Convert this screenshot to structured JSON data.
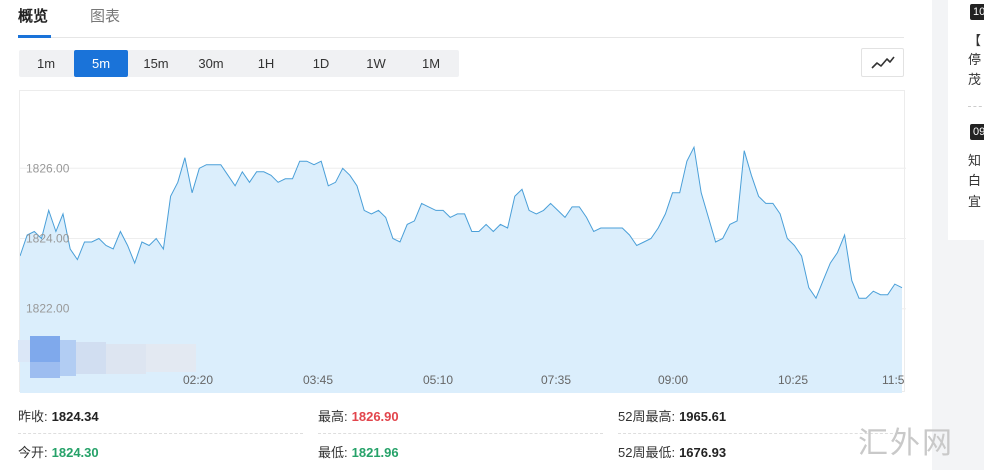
{
  "tabs": [
    {
      "label": "概览",
      "active": true
    },
    {
      "label": "图表",
      "active": false
    }
  ],
  "ranges": [
    {
      "label": "1m",
      "active": false
    },
    {
      "label": "5m",
      "active": true
    },
    {
      "label": "15m",
      "active": false
    },
    {
      "label": "30m",
      "active": false
    },
    {
      "label": "1H",
      "active": false
    },
    {
      "label": "1D",
      "active": false
    },
    {
      "label": "1W",
      "active": false
    },
    {
      "label": "1M",
      "active": false
    }
  ],
  "chart_toggle_icon": "line-chart-icon",
  "chart_data": {
    "type": "area",
    "y_ticks": [
      "1826.00",
      "1824.00",
      "1822.00"
    ],
    "y_tick_values": [
      1826,
      1824,
      1822
    ],
    "x_ticks": [
      "02:20",
      "03:45",
      "05:10",
      "07:35",
      "09:00",
      "10:25",
      "11:5"
    ],
    "ylim": [
      1819.6,
      1828.2
    ],
    "grid": true,
    "line_color": "#4a9fd8",
    "fill_color": "#dbeefc",
    "values": [
      1823.5,
      1824.1,
      1824.2,
      1824.0,
      1824.8,
      1824.2,
      1824.7,
      1823.7,
      1823.4,
      1823.9,
      1823.9,
      1824.0,
      1823.8,
      1823.7,
      1824.2,
      1823.8,
      1823.3,
      1823.9,
      1823.8,
      1824.0,
      1823.7,
      1825.2,
      1825.6,
      1826.3,
      1825.3,
      1826.0,
      1826.1,
      1826.1,
      1826.1,
      1825.8,
      1825.5,
      1825.9,
      1825.6,
      1825.9,
      1825.9,
      1825.8,
      1825.6,
      1825.7,
      1825.7,
      1826.2,
      1826.2,
      1826.1,
      1826.2,
      1825.5,
      1825.6,
      1826.0,
      1825.8,
      1825.5,
      1824.8,
      1824.7,
      1824.8,
      1824.6,
      1824.0,
      1823.9,
      1824.4,
      1824.5,
      1825.0,
      1824.9,
      1824.8,
      1824.8,
      1824.6,
      1824.7,
      1824.7,
      1824.2,
      1824.2,
      1824.4,
      1824.2,
      1824.4,
      1824.3,
      1825.2,
      1825.4,
      1824.8,
      1824.7,
      1824.8,
      1825.0,
      1824.8,
      1824.6,
      1824.9,
      1824.9,
      1824.6,
      1824.2,
      1824.3,
      1824.3,
      1824.3,
      1824.3,
      1824.1,
      1823.8,
      1823.9,
      1824.0,
      1824.3,
      1824.7,
      1825.3,
      1825.3,
      1826.2,
      1826.6,
      1825.3,
      1824.6,
      1823.9,
      1824.0,
      1824.4,
      1824.5,
      1826.5,
      1825.8,
      1825.2,
      1825.0,
      1825.0,
      1824.7,
      1824.0,
      1823.8,
      1823.5,
      1822.6,
      1822.3,
      1822.8,
      1823.3,
      1823.6,
      1824.1,
      1822.8,
      1822.3,
      1822.3,
      1822.5,
      1822.4,
      1822.4,
      1822.7,
      1822.6
    ]
  },
  "stats": [
    {
      "label": "昨收:",
      "value": "1824.34",
      "tone": "neutral"
    },
    {
      "label": "最高:",
      "value": "1826.90",
      "tone": "up"
    },
    {
      "label": "52周最高:",
      "value": "1965.61",
      "tone": "neutral"
    },
    {
      "label": "今开:",
      "value": "1824.30",
      "tone": "down"
    },
    {
      "label": "最低:",
      "value": "1821.96",
      "tone": "down"
    },
    {
      "label": "52周最低:",
      "value": "1676.93",
      "tone": "neutral"
    }
  ],
  "sidebar": {
    "items": [
      {
        "time": "10",
        "lines": [
          "【",
          "停",
          "茂"
        ]
      },
      {
        "time": "09",
        "lines": [
          "知",
          "白",
          "宜"
        ]
      }
    ]
  },
  "watermark": "汇外网"
}
